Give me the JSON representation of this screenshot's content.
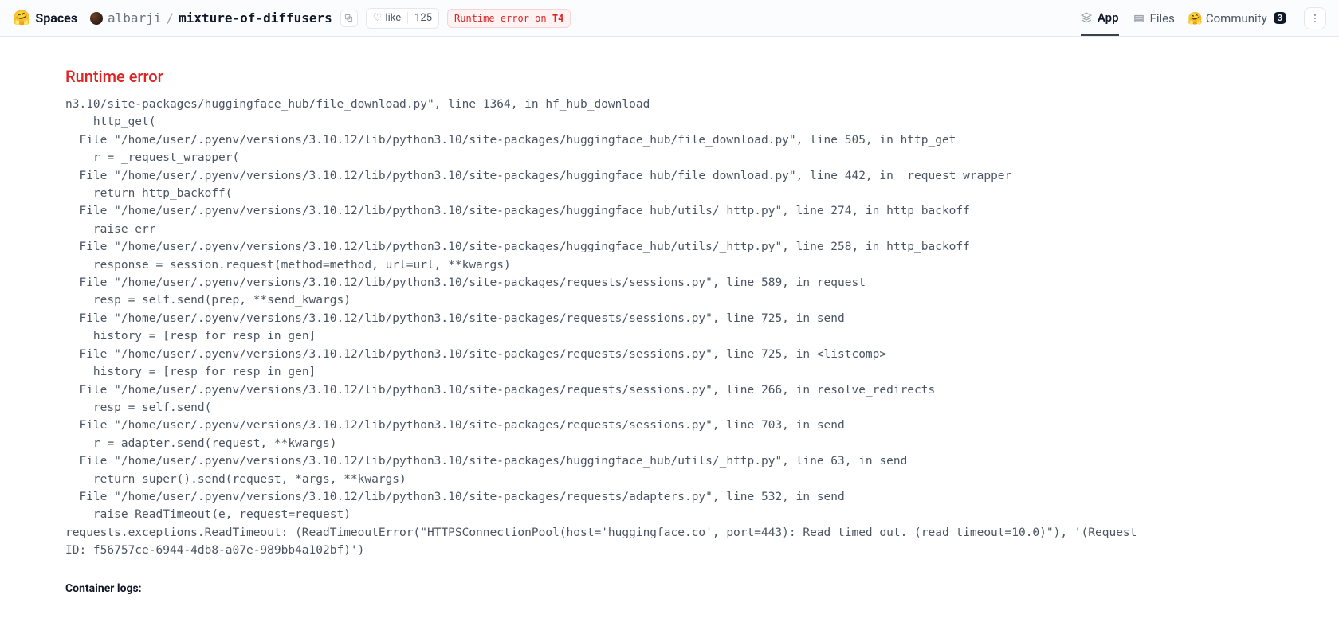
{
  "header": {
    "brand": "Spaces",
    "owner": "albarji",
    "repo": "mixture-of-diffusers",
    "like_label": "like",
    "like_count": "125",
    "status_prefix": "Runtime error on ",
    "status_hw": "T4"
  },
  "nav": {
    "app": "App",
    "files": "Files",
    "community": "Community",
    "community_count": "3"
  },
  "error": {
    "title": "Runtime error",
    "traceback": "n3.10/site-packages/huggingface_hub/file_download.py\", line 1364, in hf_hub_download\n    http_get(\n  File \"/home/user/.pyenv/versions/3.10.12/lib/python3.10/site-packages/huggingface_hub/file_download.py\", line 505, in http_get\n    r = _request_wrapper(\n  File \"/home/user/.pyenv/versions/3.10.12/lib/python3.10/site-packages/huggingface_hub/file_download.py\", line 442, in _request_wrapper\n    return http_backoff(\n  File \"/home/user/.pyenv/versions/3.10.12/lib/python3.10/site-packages/huggingface_hub/utils/_http.py\", line 274, in http_backoff\n    raise err\n  File \"/home/user/.pyenv/versions/3.10.12/lib/python3.10/site-packages/huggingface_hub/utils/_http.py\", line 258, in http_backoff\n    response = session.request(method=method, url=url, **kwargs)\n  File \"/home/user/.pyenv/versions/3.10.12/lib/python3.10/site-packages/requests/sessions.py\", line 589, in request\n    resp = self.send(prep, **send_kwargs)\n  File \"/home/user/.pyenv/versions/3.10.12/lib/python3.10/site-packages/requests/sessions.py\", line 725, in send\n    history = [resp for resp in gen]\n  File \"/home/user/.pyenv/versions/3.10.12/lib/python3.10/site-packages/requests/sessions.py\", line 725, in <listcomp>\n    history = [resp for resp in gen]\n  File \"/home/user/.pyenv/versions/3.10.12/lib/python3.10/site-packages/requests/sessions.py\", line 266, in resolve_redirects\n    resp = self.send(\n  File \"/home/user/.pyenv/versions/3.10.12/lib/python3.10/site-packages/requests/sessions.py\", line 703, in send\n    r = adapter.send(request, **kwargs)\n  File \"/home/user/.pyenv/versions/3.10.12/lib/python3.10/site-packages/huggingface_hub/utils/_http.py\", line 63, in send\n    return super().send(request, *args, **kwargs)\n  File \"/home/user/.pyenv/versions/3.10.12/lib/python3.10/site-packages/requests/adapters.py\", line 532, in send\n    raise ReadTimeout(e, request=request)\nrequests.exceptions.ReadTimeout: (ReadTimeoutError(\"HTTPSConnectionPool(host='huggingface.co', port=443): Read timed out. (read timeout=10.0)\"), '(Request ID: f56757ce-6944-4db8-a07e-989bb4a102bf)')",
    "container_logs_label": "Container logs:"
  }
}
